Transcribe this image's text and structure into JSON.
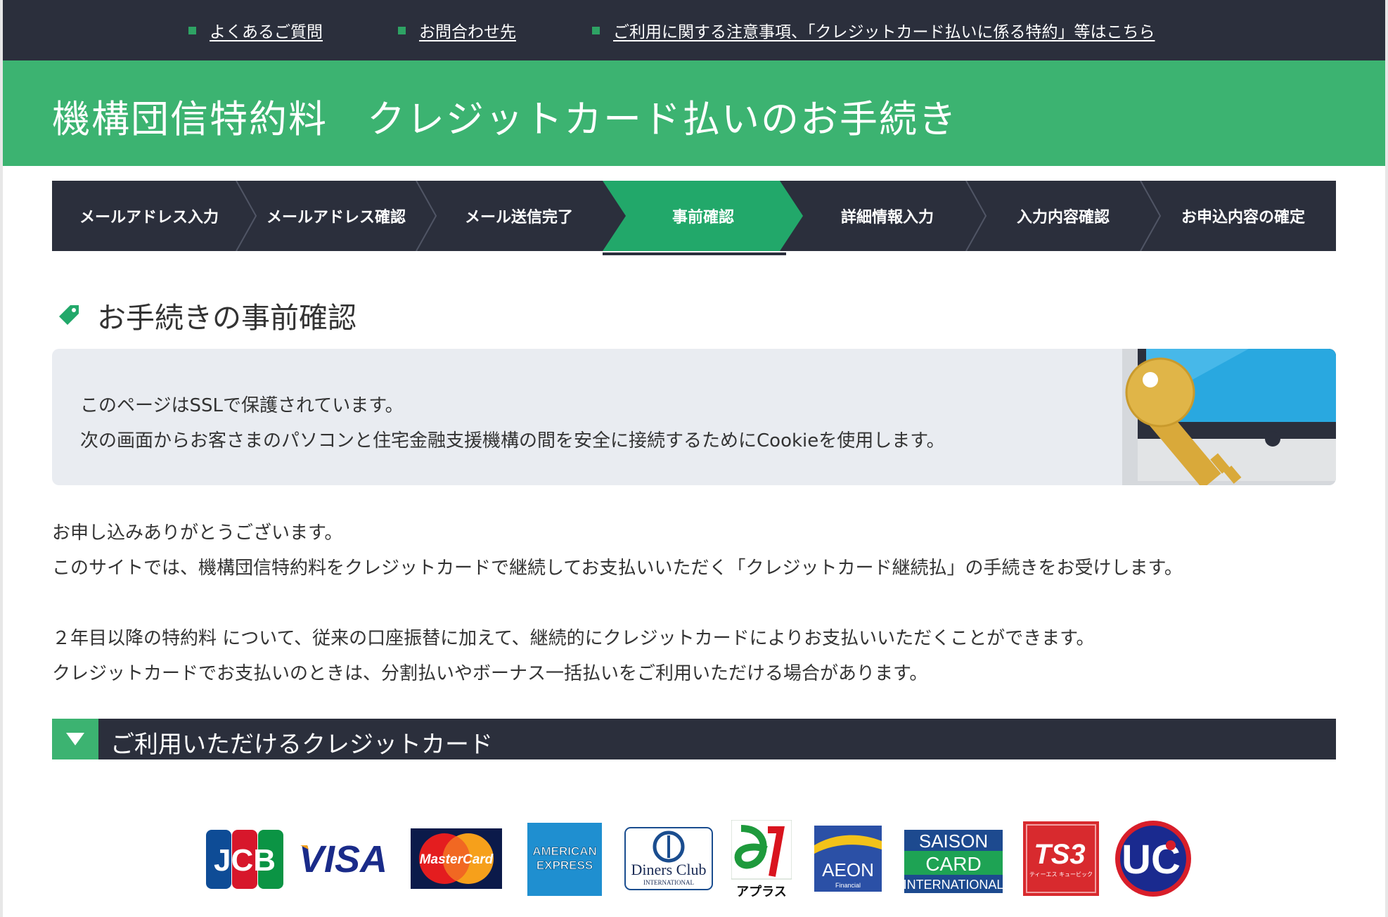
{
  "top_links": [
    {
      "label": "よくあるご質問"
    },
    {
      "label": "お問合わせ先"
    },
    {
      "label": "ご利用に関する注意事項、「クレジットカード払いに係る特約」等はこちら"
    }
  ],
  "banner": {
    "title": "機構団信特約料　クレジットカード払いのお手続き"
  },
  "steps": [
    {
      "label": "メールアドレス入力",
      "active": false
    },
    {
      "label": "メールアドレス確認",
      "active": false
    },
    {
      "label": "メール送信完了",
      "active": false
    },
    {
      "label": "事前確認",
      "active": true
    },
    {
      "label": "詳細情報入力",
      "active": false
    },
    {
      "label": "入力内容確認",
      "active": false
    },
    {
      "label": "お申込内容の確定",
      "active": false
    }
  ],
  "section": {
    "heading": "お手続きの事前確認"
  },
  "notice": {
    "line1": "このページはSSLで保護されています。",
    "line2": "次の画面からお客さまのパソコンと住宅金融支援機構の間を安全に接続するためにCookieを使用します。"
  },
  "intro": {
    "line1": "お申し込みありがとうございます。",
    "line2": "このサイトでは、機構団信特約料をクレジットカードで継続してお支払いいただく「クレジットカード継続払」の手続きをお受けします。",
    "line3": "２年目以降の特約料 について、従来の口座振替に加えて、継続的にクレジットカードによりお支払いいただくことができます。",
    "line4": "クレジットカードでお支払いのときは、分割払いやボーナス一括払いをご利用いただける場合があります。"
  },
  "cards_section": {
    "heading": "ご利用いただけるクレジットカード"
  },
  "card_logos": [
    {
      "name": "JCB",
      "text": "JCB"
    },
    {
      "name": "VISA",
      "text": "VISA"
    },
    {
      "name": "MasterCard",
      "text": "MasterCard"
    },
    {
      "name": "American Express",
      "text_line1": "AMERICAN",
      "text_line2": "EXPRESS"
    },
    {
      "name": "Diners Club",
      "text_line1": "Diners Club",
      "text_line2": "INTERNATIONAL"
    },
    {
      "name": "アプラス",
      "text": "アプラス"
    },
    {
      "name": "AEON",
      "text_line1": "AEON",
      "text_line2": "Financial"
    },
    {
      "name": "SAISON CARD",
      "text_line1": "SAISON",
      "text_line2": "CARD",
      "text_line3": "INTERNATIONAL"
    },
    {
      "name": "TS3",
      "text": "TS3",
      "sub": "ティーエス キュービック"
    },
    {
      "name": "UC",
      "text": "UC"
    }
  ],
  "colors": {
    "navy": "#2b2f3c",
    "green": "#3cb371",
    "notice_bg": "#e9ecf1"
  }
}
